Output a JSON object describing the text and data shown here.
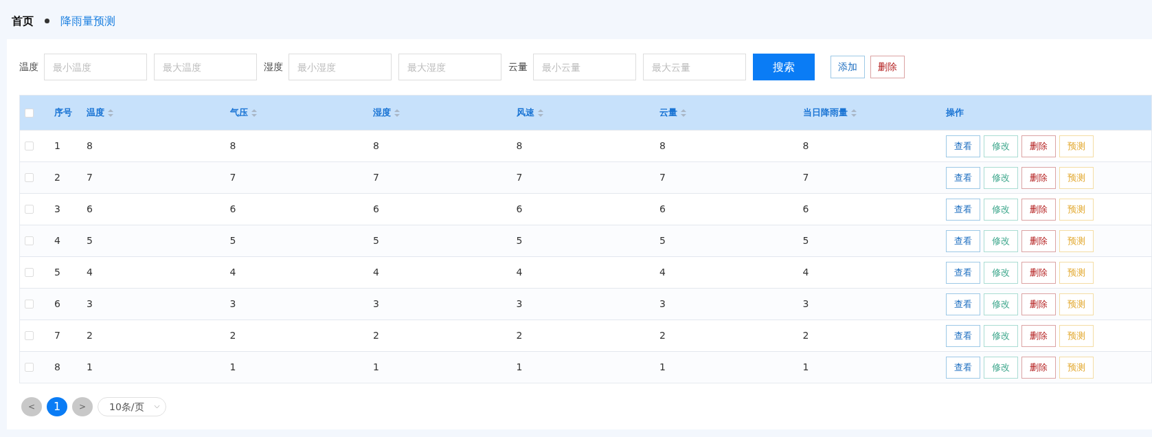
{
  "breadcrumb": [
    {
      "label": "首页",
      "selected": false
    },
    {
      "label": "降雨量预测",
      "selected": true
    }
  ],
  "filters": [
    {
      "label": "温度",
      "min_placeholder": "最小温度",
      "max_placeholder": "最大温度"
    },
    {
      "label": "湿度",
      "min_placeholder": "最小湿度",
      "max_placeholder": "最大湿度"
    },
    {
      "label": "云量",
      "min_placeholder": "最小云量",
      "max_placeholder": "最大云量"
    }
  ],
  "search_button": "搜索",
  "toolbar_buttons": [
    {
      "label": "添加",
      "kind": "add"
    },
    {
      "label": "删除",
      "kind": "delete"
    }
  ],
  "table": {
    "select_all_checked": false,
    "columns": [
      {
        "label": "序号",
        "sortable": false
      },
      {
        "label": "温度",
        "sortable": true
      },
      {
        "label": "气压",
        "sortable": true
      },
      {
        "label": "湿度",
        "sortable": true
      },
      {
        "label": "风速",
        "sortable": true
      },
      {
        "label": "云量",
        "sortable": true
      },
      {
        "label": "当日降雨量",
        "sortable": true
      },
      {
        "label": "操作",
        "sortable": false
      }
    ],
    "rows": [
      {
        "checked": false,
        "cells": [
          "1",
          "8",
          "8",
          "8",
          "8",
          "8",
          "8"
        ],
        "actions": [
          {
            "label": "查看",
            "kind": "view"
          },
          {
            "label": "修改",
            "kind": "edit"
          },
          {
            "label": "删除",
            "kind": "delete"
          },
          {
            "label": "预测",
            "kind": "predict"
          }
        ]
      },
      {
        "checked": false,
        "cells": [
          "2",
          "7",
          "7",
          "7",
          "7",
          "7",
          "7"
        ],
        "actions": [
          {
            "label": "查看",
            "kind": "view"
          },
          {
            "label": "修改",
            "kind": "edit"
          },
          {
            "label": "删除",
            "kind": "delete"
          },
          {
            "label": "预测",
            "kind": "predict"
          }
        ]
      },
      {
        "checked": false,
        "cells": [
          "3",
          "6",
          "6",
          "6",
          "6",
          "6",
          "6"
        ],
        "actions": [
          {
            "label": "查看",
            "kind": "view"
          },
          {
            "label": "修改",
            "kind": "edit"
          },
          {
            "label": "删除",
            "kind": "delete"
          },
          {
            "label": "预测",
            "kind": "predict"
          }
        ]
      },
      {
        "checked": false,
        "cells": [
          "4",
          "5",
          "5",
          "5",
          "5",
          "5",
          "5"
        ],
        "actions": [
          {
            "label": "查看",
            "kind": "view"
          },
          {
            "label": "修改",
            "kind": "edit"
          },
          {
            "label": "删除",
            "kind": "delete"
          },
          {
            "label": "预测",
            "kind": "predict"
          }
        ]
      },
      {
        "checked": false,
        "cells": [
          "5",
          "4",
          "4",
          "4",
          "4",
          "4",
          "4"
        ],
        "actions": [
          {
            "label": "查看",
            "kind": "view"
          },
          {
            "label": "修改",
            "kind": "edit"
          },
          {
            "label": "删除",
            "kind": "delete"
          },
          {
            "label": "预测",
            "kind": "predict"
          }
        ]
      },
      {
        "checked": false,
        "cells": [
          "6",
          "3",
          "3",
          "3",
          "3",
          "3",
          "3"
        ],
        "actions": [
          {
            "label": "查看",
            "kind": "view"
          },
          {
            "label": "修改",
            "kind": "edit"
          },
          {
            "label": "删除",
            "kind": "delete"
          },
          {
            "label": "预测",
            "kind": "predict"
          }
        ]
      },
      {
        "checked": false,
        "cells": [
          "7",
          "2",
          "2",
          "2",
          "2",
          "2",
          "2"
        ],
        "actions": [
          {
            "label": "查看",
            "kind": "view"
          },
          {
            "label": "修改",
            "kind": "edit"
          },
          {
            "label": "删除",
            "kind": "delete"
          },
          {
            "label": "预测",
            "kind": "predict"
          }
        ]
      },
      {
        "checked": false,
        "cells": [
          "8",
          "1",
          "1",
          "1",
          "1",
          "1",
          "1"
        ],
        "actions": [
          {
            "label": "查看",
            "kind": "view"
          },
          {
            "label": "修改",
            "kind": "edit"
          },
          {
            "label": "删除",
            "kind": "delete"
          },
          {
            "label": "预测",
            "kind": "predict"
          }
        ]
      }
    ]
  },
  "pagination": {
    "prev": "<",
    "next": ">",
    "pages": [
      {
        "label": "1",
        "selected": true
      }
    ],
    "page_size": "10条/页"
  }
}
